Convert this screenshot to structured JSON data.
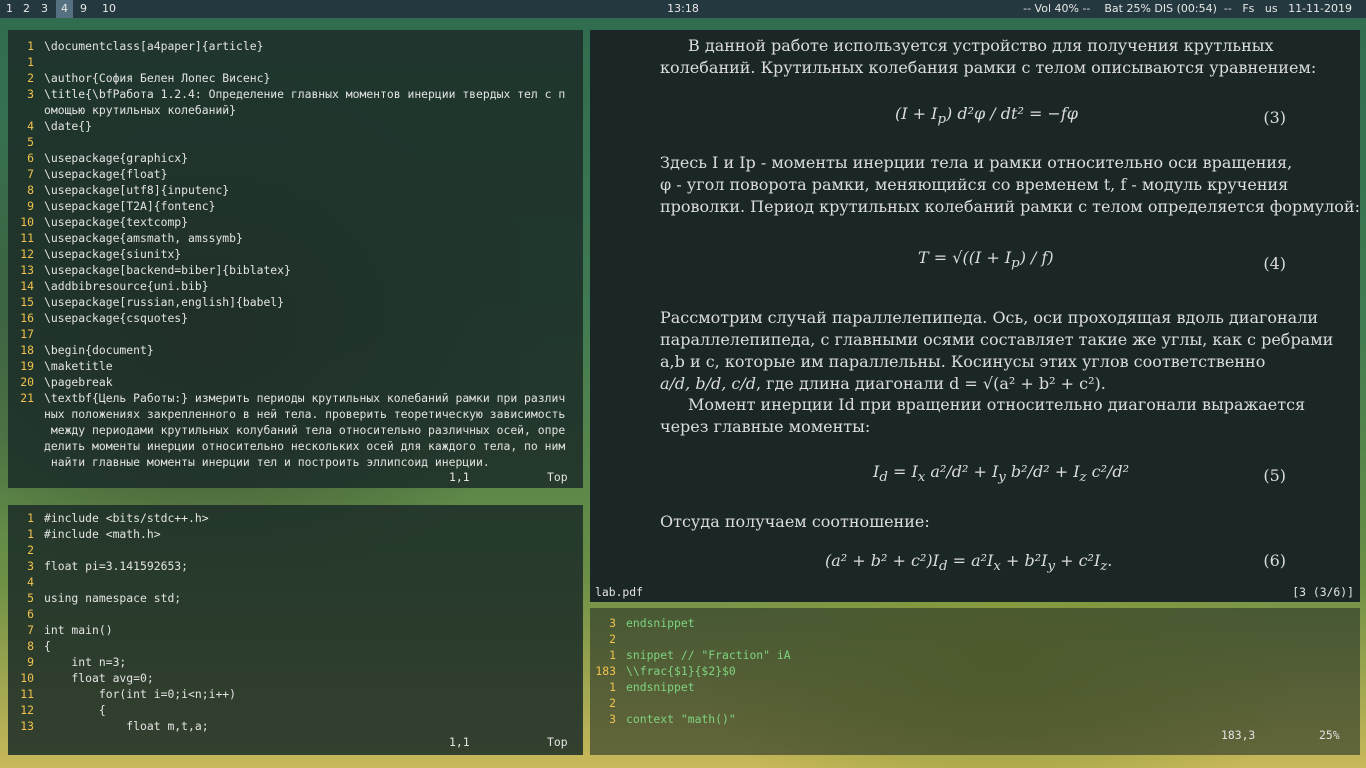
{
  "topbar": {
    "workspaces": [
      "1",
      "2",
      "3",
      "4",
      "9",
      "10"
    ],
    "active": "4",
    "clock": "13:18",
    "status": "-- Vol 40% --    Bat 25% DIS (00:54)  --   Fs   us   11-11-2019"
  },
  "tex_editor": {
    "lines": [
      {
        "n": "1",
        "text": "\\documentclass[a4paper]{article}"
      },
      {
        "n": "1",
        "text": ""
      },
      {
        "n": "2",
        "text": "\\author{София Белен Лопес Висенс}"
      },
      {
        "n": "3",
        "text": "\\title{\\bfРабота 1.2.4: Определение главных моментов инерции твердых тел с п"
      },
      {
        "n": "",
        "text": "омощью крутильных колебаний}"
      },
      {
        "n": "4",
        "text": "\\date{}"
      },
      {
        "n": "5",
        "text": ""
      },
      {
        "n": "6",
        "text": "\\usepackage{graphicx}"
      },
      {
        "n": "7",
        "text": "\\usepackage{float}"
      },
      {
        "n": "8",
        "text": "\\usepackage[utf8]{inputenc}"
      },
      {
        "n": "9",
        "text": "\\usepackage[T2A]{fontenc}"
      },
      {
        "n": "10",
        "text": "\\usepackage{textcomp}"
      },
      {
        "n": "11",
        "text": "\\usepackage{amsmath, amssymb}"
      },
      {
        "n": "12",
        "text": "\\usepackage{siunitx}"
      },
      {
        "n": "13",
        "text": "\\usepackage[backend=biber]{biblatex}"
      },
      {
        "n": "14",
        "text": "\\addbibresource{uni.bib}"
      },
      {
        "n": "15",
        "text": "\\usepackage[russian,english]{babel}"
      },
      {
        "n": "16",
        "text": "\\usepackage{csquotes}"
      },
      {
        "n": "17",
        "text": ""
      },
      {
        "n": "18",
        "text": "\\begin{document}"
      },
      {
        "n": "19",
        "text": "\\maketitle"
      },
      {
        "n": "20",
        "text": "\\pagebreak"
      },
      {
        "n": "21",
        "text": "\\textbf{Цель Работы:} измерить периоды крутильных колебаний рамки при различ"
      },
      {
        "n": "",
        "text": "ных положениях закрепленного в ней тела. проверить теоретическую зависимость"
      },
      {
        "n": "",
        "text": " между периодами крутильных колубаний тела относительно различных осей, опре"
      },
      {
        "n": "",
        "text": "делить моменты инерции относительно нескольких осей для каждого тела, по ним"
      },
      {
        "n": "",
        "text": " найти главные моменты инерции тел и построить эллипсоид инерции."
      }
    ],
    "position": "1,1",
    "scroll": "Top"
  },
  "cpp_editor": {
    "lines": [
      {
        "n": "1",
        "text": "#include <bits/stdc++.h>"
      },
      {
        "n": "1",
        "text": "#include <math.h>"
      },
      {
        "n": "2",
        "text": ""
      },
      {
        "n": "3",
        "text": "float pi=3.141592653;"
      },
      {
        "n": "4",
        "text": ""
      },
      {
        "n": "5",
        "text": "using namespace std;"
      },
      {
        "n": "6",
        "text": ""
      },
      {
        "n": "7",
        "text": "int main()"
      },
      {
        "n": "8",
        "text": "{"
      },
      {
        "n": "9",
        "text": "    int n=3;"
      },
      {
        "n": "10",
        "text": "    float avg=0;"
      },
      {
        "n": "11",
        "text": "        for(int i=0;i<n;i++)"
      },
      {
        "n": "12",
        "text": "        {"
      },
      {
        "n": "13",
        "text": "            float m,t,a;"
      }
    ],
    "position": "1,1",
    "scroll": "Top"
  },
  "snippet_editor": {
    "lines": [
      {
        "n": "3",
        "text": "endsnippet"
      },
      {
        "n": "2",
        "text": ""
      },
      {
        "n": "1",
        "text": "snippet // \"Fraction\" iA"
      },
      {
        "n": "183",
        "text": "\\\\frac{$1}{$2}$0"
      },
      {
        "n": "1",
        "text": "endsnippet"
      },
      {
        "n": "2",
        "text": ""
      },
      {
        "n": "3",
        "text": "context \"math()\""
      }
    ],
    "position": "183,3",
    "scroll": "25%"
  },
  "pdf": {
    "filename": "lab.pdf",
    "page": "[3 (3/6)]",
    "para1": [
      "В данной работе используется устройство для получения крутльных",
      "колебаний. Крутильных колебания рамки с телом описываются уравнением:"
    ],
    "para2": [
      "Здесь I и Ip - моменты инерции тела и рамки относительно оси вращения,",
      "φ - угол поворота рамки, меняющийся со временем t, f - модуль кручения",
      "проволки. Период крутильных колебаний рамки с телом определяется формулой:"
    ],
    "para3": [
      "Рассмотрим случай параллелепипеда. Ось, оси проходящая вдоль диагонали",
      "параллелепипеда, с главными осями составляет такие же углы, как с ребрами",
      "a,b и c, которые им параллельны.  Косинусы этих углов соответственно"
    ],
    "para3_last": ", где длина диагонали d = √(a² + b² + c²).",
    "para4": [
      "Момент инерции Id при вращении относительно диагонали выражается",
      "через главные моменты:"
    ],
    "para5": "Отсуда получаем соотношение:",
    "eq_numbers": [
      "(3)",
      "(4)",
      "(5)",
      "(6)"
    ]
  }
}
